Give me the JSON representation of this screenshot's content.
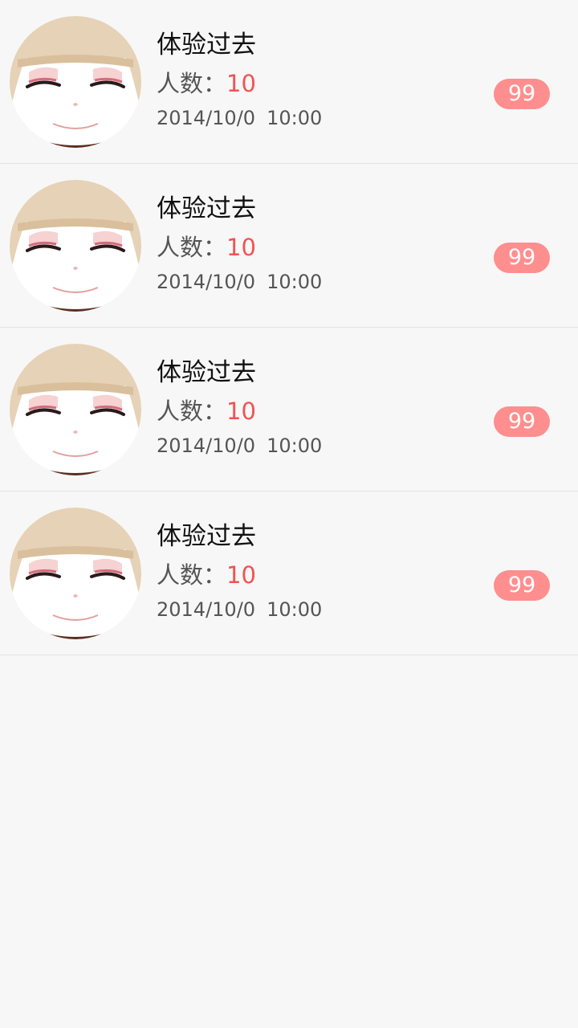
{
  "list": {
    "items": [
      {
        "title": "体验过去",
        "count_label": "人数：",
        "count_value": "10",
        "date": "2014/10/0",
        "time": "10:00",
        "badge": "99"
      },
      {
        "title": "体验过去",
        "count_label": "人数：",
        "count_value": "10",
        "date": "2014/10/0",
        "time": "10:00",
        "badge": "99"
      },
      {
        "title": "体验过去",
        "count_label": "人数：",
        "count_value": "10",
        "date": "2014/10/0",
        "time": "10:00",
        "badge": "99"
      },
      {
        "title": "体验过去",
        "count_label": "人数：",
        "count_value": "10",
        "date": "2014/10/0",
        "time": "10:00",
        "badge": "99"
      }
    ]
  },
  "icons": {
    "avatar": "smiling-cartoon-face-avatar"
  },
  "colors": {
    "accent_count": "#f25252",
    "badge_bg": "#ff8e8e",
    "background": "#f7f7f7"
  }
}
